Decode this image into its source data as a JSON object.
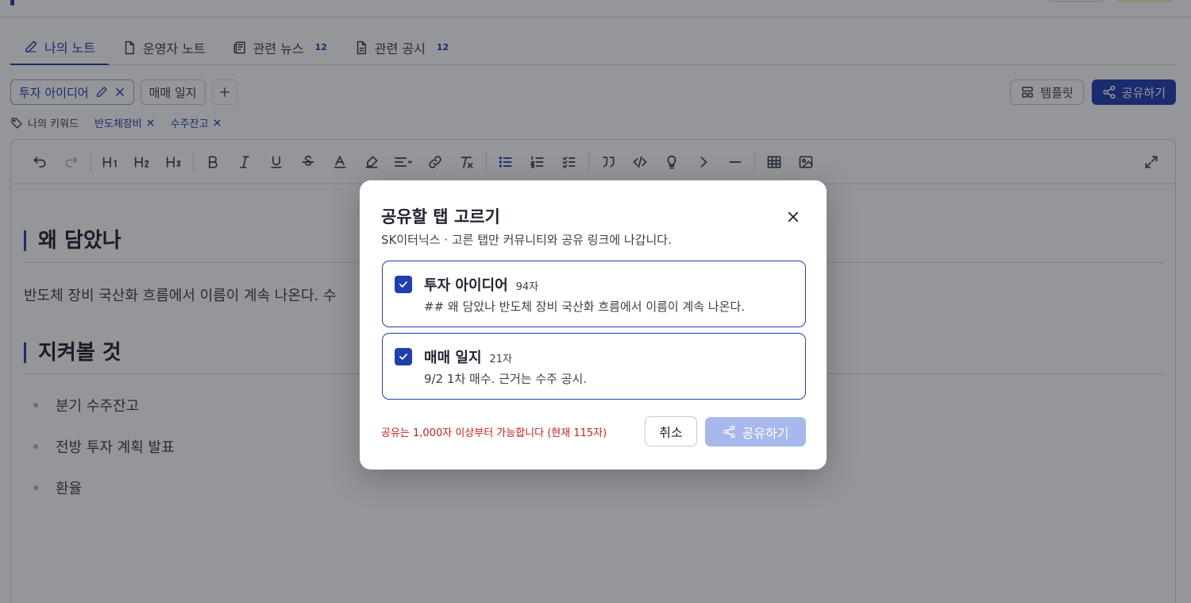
{
  "tabs": [
    {
      "label": "나의 노트",
      "icon": "pencil-icon",
      "count": ""
    },
    {
      "label": "운영자 노트",
      "icon": "document-icon",
      "count": ""
    },
    {
      "label": "관련 뉴스",
      "icon": "newspaper-icon",
      "count": "12"
    },
    {
      "label": "관련 공시",
      "icon": "file-text-icon",
      "count": "12"
    }
  ],
  "note_tabs": [
    {
      "label": "투자 아이디어"
    },
    {
      "label": "매매 일지"
    }
  ],
  "actions": {
    "template_label": "템플릿",
    "share_label": "공유하기"
  },
  "keywords": {
    "label": "나의 키워드",
    "items": [
      "반도체장비",
      "수주잔고"
    ]
  },
  "document": {
    "heading1": "왜 담았나",
    "paragraph": "반도체 장비 국산화 흐름에서 이름이 계속 나온다. 수",
    "heading2": "지켜볼 것",
    "bullets": [
      "분기 수주잔고",
      "전방 투자 계획 발표",
      "환율"
    ]
  },
  "modal": {
    "title": "공유할 탭 고르기",
    "subtitle": "SK이터닉스 · 고른 탭만 커뮤니티와 공유 링크에 나갑니다.",
    "items": [
      {
        "name": "투자 아이디어",
        "count": "94자",
        "preview": "## 왜 담았나 반도체 장비 국산화 흐름에서 이름이 계속 나온다.",
        "checked": true
      },
      {
        "name": "매매 일지",
        "count": "21자",
        "preview": "9/2 1차 매수. 근거는 수주 공시.",
        "checked": true
      }
    ],
    "warning": "공유는 1,000자 이상부터 가능합니다 (현재 115자)",
    "cancel_label": "취소",
    "share_label": "공유하기"
  },
  "colors": {
    "accent": "#1f3fb0",
    "warning": "#d11a1a",
    "disabled_button": "#a9b8ec"
  }
}
